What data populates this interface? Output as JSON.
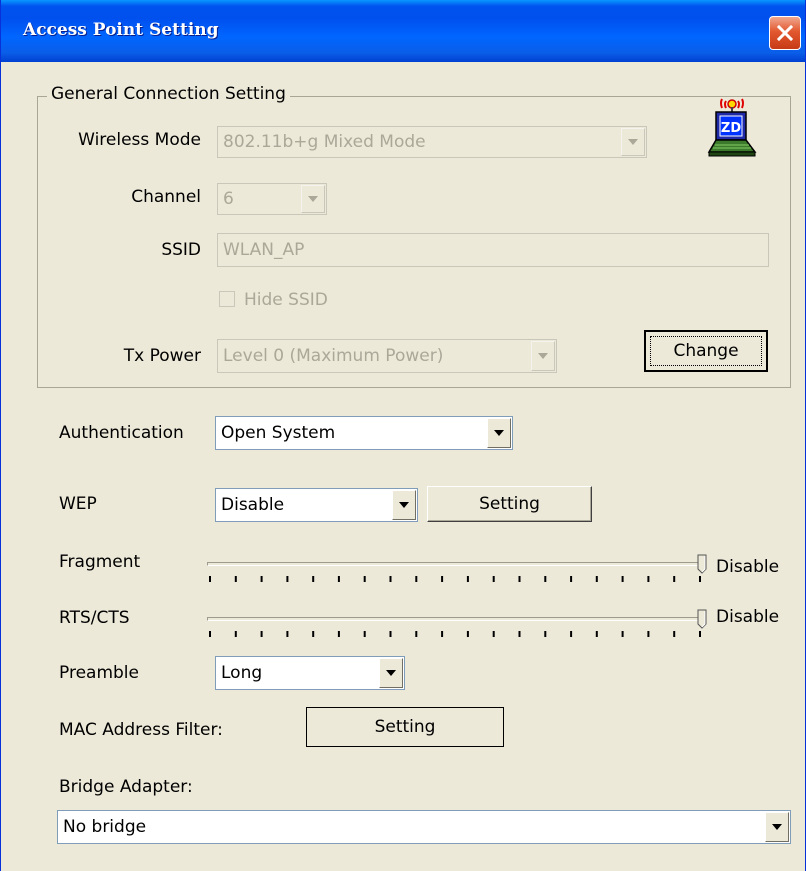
{
  "window": {
    "title": "Access Point Setting"
  },
  "general": {
    "legend": "General Connection Setting",
    "wireless_mode": {
      "label": "Wireless Mode",
      "value": "802.11b+g Mixed Mode"
    },
    "channel": {
      "label": "Channel",
      "value": "6"
    },
    "ssid": {
      "label": "SSID",
      "value": "WLAN_AP"
    },
    "hide_ssid": {
      "label": "Hide SSID",
      "checked": false
    },
    "tx_power": {
      "label": "Tx Power",
      "value": "Level 0 (Maximum Power)"
    },
    "change_label": "Change",
    "icon": {
      "name": "wireless-computer-icon",
      "badge": "ZD"
    }
  },
  "authentication": {
    "label": "Authentication",
    "value": "Open System"
  },
  "wep": {
    "label": "WEP",
    "value": "Disable",
    "setting_label": "Setting"
  },
  "fragment": {
    "label": "Fragment",
    "value_label": "Disable",
    "level": 1.0
  },
  "rts_cts": {
    "label": "RTS/CTS",
    "value_label": "Disable",
    "level": 1.0
  },
  "preamble": {
    "label": "Preamble",
    "value": "Long"
  },
  "mac_filter": {
    "label": "MAC Address Filter:",
    "setting_label": "Setting"
  },
  "bridge": {
    "label": "Bridge Adapter:",
    "value": "No bridge"
  },
  "colors": {
    "title_bar": "#0054e3",
    "window_bg": "#ece9d8",
    "close_button": "#e2582f",
    "disabled_text": "#aca899"
  }
}
